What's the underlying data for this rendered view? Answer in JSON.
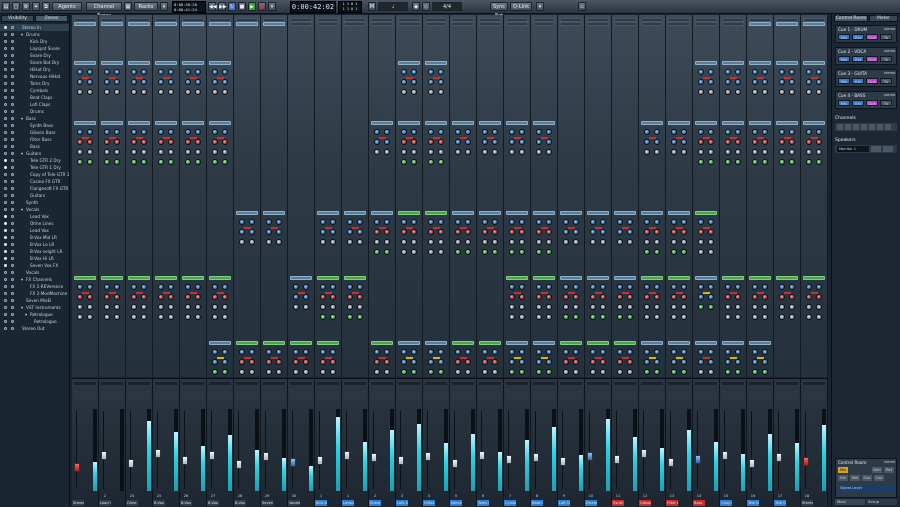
{
  "toolbar": {
    "agents_label": "Agents",
    "channel_types_label": "Channel Types",
    "racks_label": "Racks",
    "time_primary": "0:00:42:02",
    "time_small_a": "0:00:30:28",
    "time_small_b": "0:00:41:24",
    "sync_label": "Sync Ext",
    "qlink_label": "Q-Link"
  },
  "left_panel": {
    "tabs": [
      "Visibility",
      "Zones"
    ],
    "items": [
      {
        "label": "Stereo In",
        "dot": true,
        "indent": 0
      },
      {
        "label": "Drums",
        "dot": false,
        "indent": 1,
        "group": true
      },
      {
        "label": "Kick Dry",
        "dot": false,
        "indent": 2
      },
      {
        "label": "Layspot Snare",
        "dot": false,
        "indent": 2
      },
      {
        "label": "Snare Dry",
        "dot": false,
        "indent": 2
      },
      {
        "label": "Snare Bot Dry",
        "dot": false,
        "indent": 2
      },
      {
        "label": "HiHat Dry",
        "dot": false,
        "indent": 2
      },
      {
        "label": "Nervous HiHat",
        "dot": false,
        "indent": 2
      },
      {
        "label": "Toms Dry",
        "dot": false,
        "indent": 2
      },
      {
        "label": "Cymbals",
        "dot": false,
        "indent": 2
      },
      {
        "label": "Beat Claps",
        "dot": false,
        "indent": 2
      },
      {
        "label": "Lofi Claps",
        "dot": false,
        "indent": 2
      },
      {
        "label": "Drums",
        "dot": false,
        "indent": 2
      },
      {
        "label": "Bass",
        "dot": false,
        "indent": 1,
        "group": true
      },
      {
        "label": "Synth Bass",
        "dot": false,
        "indent": 2
      },
      {
        "label": "Gibson Bass",
        "dot": false,
        "indent": 2
      },
      {
        "label": "Filter Bass",
        "dot": false,
        "indent": 2
      },
      {
        "label": "Bass",
        "dot": false,
        "indent": 2
      },
      {
        "label": "Guitars",
        "dot": false,
        "indent": 1,
        "group": true
      },
      {
        "label": "Tele GTR 2 Dry",
        "dot": true,
        "indent": 2
      },
      {
        "label": "Tele GTR 1 Dry",
        "dot": true,
        "indent": 2
      },
      {
        "label": "Copy of Tele GTR 1 1",
        "dot": false,
        "indent": 2
      },
      {
        "label": "Casino FX GTR",
        "dot": false,
        "indent": 2
      },
      {
        "label": "Flangesoft FX GTR",
        "dot": false,
        "indent": 2
      },
      {
        "label": "Guitars",
        "dot": false,
        "indent": 2
      },
      {
        "label": "Synth",
        "dot": false,
        "indent": 1
      },
      {
        "label": "Vocals",
        "dot": false,
        "indent": 1,
        "group": true
      },
      {
        "label": "Lead Vox",
        "dot": true,
        "indent": 2
      },
      {
        "label": "Ohhe Lines",
        "dot": true,
        "indent": 2
      },
      {
        "label": "Lead Vox",
        "dot": true,
        "indent": 2
      },
      {
        "label": "B-Vox Mid LR",
        "dot": true,
        "indent": 2
      },
      {
        "label": "B-Vox Lo LR",
        "dot": true,
        "indent": 2
      },
      {
        "label": "B-Vox seight LR",
        "dot": true,
        "indent": 2
      },
      {
        "label": "B-Vox Hi LR",
        "dot": true,
        "indent": 2
      },
      {
        "label": "Seven Vox FX",
        "dot": true,
        "indent": 2
      },
      {
        "label": "Vocals",
        "dot": false,
        "indent": 1
      },
      {
        "label": "FX Channels",
        "dot": false,
        "indent": 1,
        "group": true
      },
      {
        "label": "FX 1-REVerence",
        "dot": false,
        "indent": 2
      },
      {
        "label": "FX 2-ModMachine",
        "dot": false,
        "indent": 2
      },
      {
        "label": "Seven MixEl",
        "dot": false,
        "indent": 1
      },
      {
        "label": "VST Instruments",
        "dot": false,
        "indent": 1,
        "group": true
      },
      {
        "label": "Retrologue",
        "dot": false,
        "indent": 2,
        "group": true
      },
      {
        "label": "Retrologue",
        "dot": false,
        "indent": 3
      },
      {
        "label": "Stereo Out",
        "dot": false,
        "indent": 0
      }
    ]
  },
  "mixer": {
    "channels": [
      {
        "name": "Stereo In",
        "num": "",
        "level": 0.35,
        "fader": 0.25,
        "fcolor": "red",
        "hl": ""
      },
      {
        "name": "Lead Vox",
        "num": "2",
        "level": 0.0,
        "fader": 0.42,
        "fcolor": "white",
        "hl": ""
      },
      {
        "name": "Ohhe Lines",
        "num": "24",
        "level": 0.85,
        "fader": 0.3,
        "fcolor": "white",
        "hl": ""
      },
      {
        "name": "B-Vox Mid LR",
        "num": "25",
        "level": 0.72,
        "fader": 0.45,
        "fcolor": "white",
        "hl": ""
      },
      {
        "name": "B-Vox Lo LR",
        "num": "26",
        "level": 0.55,
        "fader": 0.35,
        "fcolor": "white",
        "hl": ""
      },
      {
        "name": "B-Vox seight LR",
        "num": "27",
        "level": 0.68,
        "fader": 0.42,
        "fcolor": "white",
        "hl": ""
      },
      {
        "name": "B-Vox Hi LR",
        "num": "28",
        "level": 0.5,
        "fader": 0.28,
        "fcolor": "white",
        "hl": ""
      },
      {
        "name": "Seven Vox FX",
        "num": "29",
        "level": 0.4,
        "fader": 0.4,
        "fcolor": "white",
        "hl": ""
      },
      {
        "name": "Vocals",
        "num": "30",
        "level": 0.3,
        "fader": 0.32,
        "fcolor": "blue",
        "hl": ""
      },
      {
        "name": "Kick Dry",
        "num": "1",
        "level": 0.9,
        "fader": 0.35,
        "fcolor": "white",
        "hl": "blue"
      },
      {
        "name": "Layspot Snare",
        "num": "1",
        "level": 0.6,
        "fader": 0.42,
        "fcolor": "white",
        "hl": "blue"
      },
      {
        "name": "Snare Dry",
        "num": "2",
        "level": 0.75,
        "fader": 0.38,
        "fcolor": "white",
        "hl": "blue"
      },
      {
        "name": "Lofe Drum",
        "num": "3",
        "level": 0.82,
        "fader": 0.34,
        "fcolor": "white",
        "hl": "blue"
      },
      {
        "name": "HiHat Dry",
        "num": "4",
        "level": 0.58,
        "fader": 0.4,
        "fcolor": "white",
        "hl": "blue"
      },
      {
        "name": "Nervous HiHat",
        "num": "5",
        "level": 0.7,
        "fader": 0.3,
        "fcolor": "white",
        "hl": "blue"
      },
      {
        "name": "Toms Dry",
        "num": "6",
        "level": 0.48,
        "fader": 0.42,
        "fcolor": "white",
        "hl": "blue"
      },
      {
        "name": "Cymbals",
        "num": "7",
        "level": 0.62,
        "fader": 0.36,
        "fcolor": "white",
        "hl": "blue"
      },
      {
        "name": "Beat Claps",
        "num": "8",
        "level": 0.78,
        "fader": 0.38,
        "fcolor": "white",
        "hl": "blue"
      },
      {
        "name": "Lofi Claps",
        "num": "9",
        "level": 0.44,
        "fader": 0.33,
        "fcolor": "white",
        "hl": "blue"
      },
      {
        "name": "Drums",
        "num": "10",
        "level": 0.88,
        "fader": 0.4,
        "fcolor": "blue",
        "hl": "blue"
      },
      {
        "name": "Synth Bass",
        "num": "11",
        "level": 0.66,
        "fader": 0.36,
        "fcolor": "white",
        "hl": "red"
      },
      {
        "name": "Gibson Bass",
        "num": "12",
        "level": 0.52,
        "fader": 0.44,
        "fcolor": "white",
        "hl": "red"
      },
      {
        "name": "Filter Bass",
        "num": "13",
        "level": 0.74,
        "fader": 0.32,
        "fcolor": "white",
        "hl": "red"
      },
      {
        "name": "Bass",
        "num": "14",
        "level": 0.6,
        "fader": 0.36,
        "fcolor": "blue",
        "hl": "red"
      },
      {
        "name": "Copy of Tele",
        "num": "15",
        "level": 0.45,
        "fader": 0.42,
        "fcolor": "white",
        "hl": "blue"
      },
      {
        "name": "Tele GTR 2 Dry",
        "num": "16",
        "level": 0.7,
        "fader": 0.3,
        "fcolor": "white",
        "hl": "blue"
      },
      {
        "name": "Tele GTR 1 Dry",
        "num": "17",
        "level": 0.58,
        "fader": 0.38,
        "fcolor": "white",
        "hl": "blue"
      },
      {
        "name": "Stereo Out",
        "num": "18",
        "level": 0.8,
        "fader": 0.33,
        "fcolor": "red",
        "hl": ""
      }
    ]
  },
  "right_panel": {
    "tabs": [
      "Control Room",
      "Meter"
    ],
    "cues": [
      {
        "title": "Cue 1 - DRUM",
        "mode": "stereo"
      },
      {
        "title": "Cue 2 - VOCA",
        "mode": "stereo"
      },
      {
        "title": "Cue 3 - GUITA",
        "mode": "stereo"
      },
      {
        "title": "Cue 4 - BASS",
        "mode": "stereo"
      }
    ],
    "mini_labels": [
      "Mix",
      "Ext",
      "Click",
      "Tk"
    ],
    "channels_title": "Channels",
    "speakers_title": "Speakers",
    "speakers_value": "Monitor 1",
    "cr_title": "Control Room",
    "cr_mode": "stereo",
    "cr_buttons": [
      "Mix",
      "Dim",
      "Ref",
      "Ext",
      "Talk",
      "Cue",
      "Cue"
    ],
    "signal_label": "Signal Level",
    "bottom_tabs": [
      "Main",
      "Setup"
    ]
  },
  "colors": {
    "meter": "#29d3e6",
    "accent_blue": "#3c8fd8",
    "accent_red": "#d83030",
    "accent_purple": "#c040c8"
  }
}
